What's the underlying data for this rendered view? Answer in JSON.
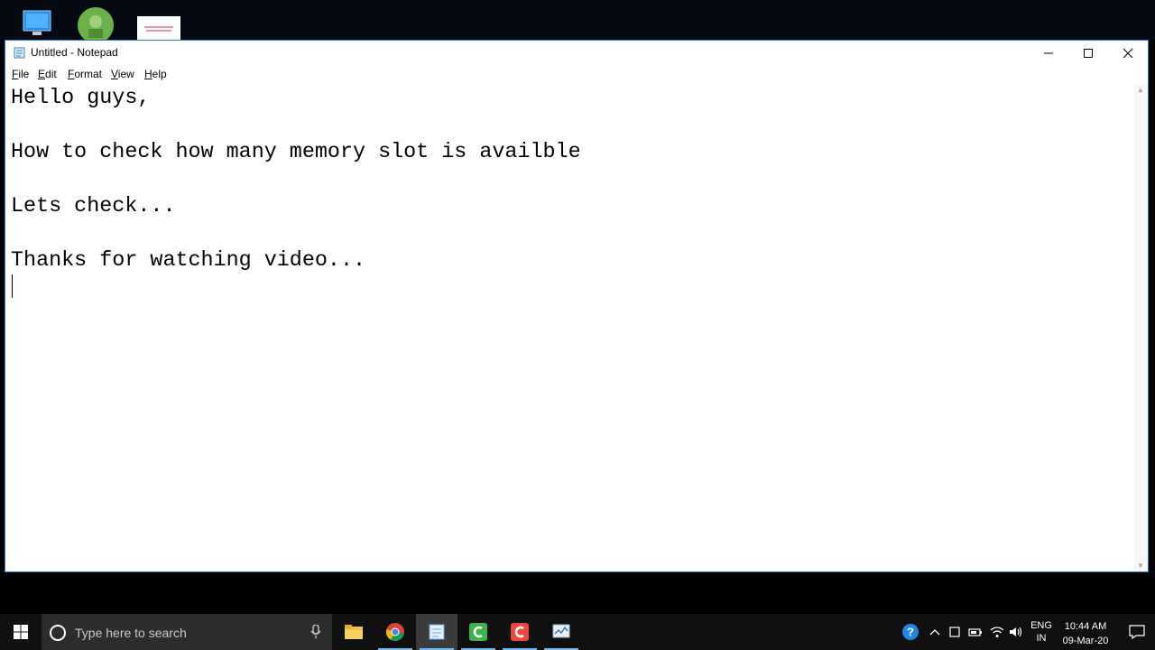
{
  "window": {
    "title": "Untitled - Notepad"
  },
  "menu": {
    "items": [
      {
        "first": "F",
        "rest": "ile"
      },
      {
        "first": "E",
        "rest": "dit"
      },
      {
        "first": "F",
        "rest": "ormat"
      },
      {
        "first": "V",
        "rest": "iew"
      },
      {
        "first": "H",
        "rest": "elp"
      }
    ]
  },
  "editor": {
    "lines": [
      "Hello guys,",
      "",
      "How to check how many memory slot is availble",
      "",
      "Lets check...",
      "",
      "Thanks for watching video..."
    ]
  },
  "taskbar": {
    "search_placeholder": "Type here to search",
    "apps": [
      "file-explorer",
      "chrome",
      "notepad",
      "camtasia-green",
      "camtasia-red",
      "task-manager"
    ]
  },
  "tray": {
    "lang_top": "ENG",
    "lang_bottom": "IN",
    "time": "10:44 AM",
    "date": "09-Mar-20"
  },
  "colors": {
    "window_border": "#2a7ad0",
    "taskbar_bg": "#101010",
    "search_bg": "#2d2d2d"
  }
}
